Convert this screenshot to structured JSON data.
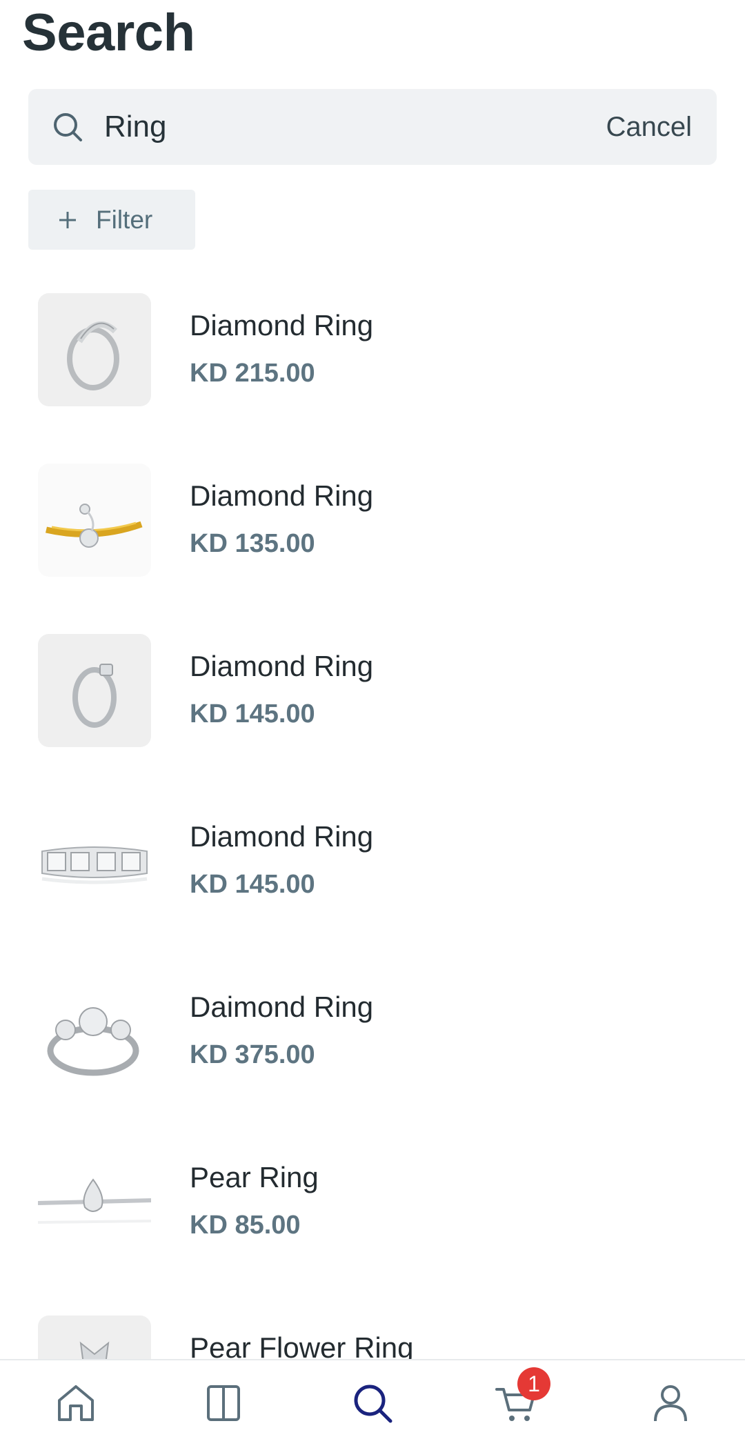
{
  "header": {
    "title": "Search"
  },
  "search": {
    "value": "Ring",
    "cancel_label": "Cancel"
  },
  "filter": {
    "label": "Filter"
  },
  "results": [
    {
      "name": "Diamond Ring",
      "price": "KD 215.00",
      "image": "silver crossover diamond ring"
    },
    {
      "name": "Diamond Ring",
      "price": "KD 135.00",
      "image": "gold ring with diamonds"
    },
    {
      "name": "Diamond Ring",
      "price": "KD 145.00",
      "image": "silver diamond ring"
    },
    {
      "name": "Diamond Ring",
      "price": "KD 145.00",
      "image": "diamond eternity band"
    },
    {
      "name": "Daimond Ring",
      "price": "KD 375.00",
      "image": "three-stone diamond ring"
    },
    {
      "name": "Pear Ring",
      "price": "KD 85.00",
      "image": "pear cluster diamond ring"
    },
    {
      "name": "Pear Flower Ring",
      "price": "",
      "image": "flower diamond ring"
    }
  ],
  "tab_bar": {
    "tabs": [
      {
        "name": "home",
        "icon": "home-icon",
        "active": false
      },
      {
        "name": "catalog",
        "icon": "split-panel-icon",
        "active": false
      },
      {
        "name": "search",
        "icon": "search-icon",
        "active": true
      },
      {
        "name": "cart",
        "icon": "cart-icon",
        "active": false,
        "badge": "1"
      },
      {
        "name": "account",
        "icon": "user-icon",
        "active": false
      }
    ]
  },
  "colors": {
    "active_tab": "#1a237e",
    "inactive_tab": "#5b6f7b",
    "badge": "#e53935",
    "price": "#5d7481",
    "search_bg": "#f0f2f4"
  }
}
